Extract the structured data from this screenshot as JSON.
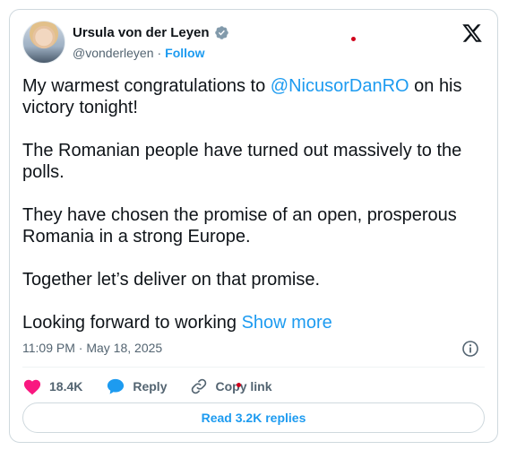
{
  "author": {
    "name": "Ursula von der Leyen",
    "handle": "@vonderleyen",
    "separator": "·",
    "follow_label": "Follow",
    "verified_icon": "verified-badge-icon"
  },
  "platform_logo": "x-logo-icon",
  "tweet": {
    "p1_before": "My warmest congratulations to ",
    "p1_mention": "@NicusorDanRO",
    "p1_after": " on his victory tonight!",
    "p2": "The Romanian people have turned out massively to the polls.",
    "p3": "They have chosen the promise of an open, prosperous Romania in a strong Europe.",
    "p4": "Together let’s deliver on that promise.",
    "p5_before": "Looking forward to working ",
    "show_more": "Show more"
  },
  "meta": {
    "time": "11:09 PM",
    "separator": "·",
    "date": "May 18, 2025"
  },
  "actions": {
    "likes": "18.4K",
    "reply": "Reply",
    "copy_link": "Copy link"
  },
  "replies_button": "Read 3.2K replies",
  "colors": {
    "accent": "#1d9bf0",
    "like": "#f91880",
    "text": "#0f1419",
    "muted": "#536471",
    "border": "#cfd9de"
  }
}
